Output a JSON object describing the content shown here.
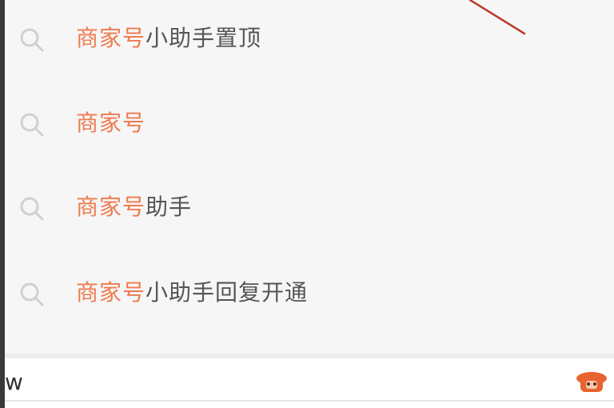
{
  "suggestions": [
    {
      "highlight": "商家号",
      "rest": "小助手置顶",
      "icon": "search-icon"
    },
    {
      "highlight": "商家号",
      "rest": "",
      "icon": "search-icon"
    },
    {
      "highlight": "商家号",
      "rest": "助手",
      "icon": "search-icon"
    },
    {
      "highlight": "商家号",
      "rest": "小助手回复开通",
      "icon": "search-icon"
    }
  ],
  "input_bar": {
    "text": "w",
    "app_icon": "orange-app-icon"
  },
  "colors": {
    "highlight": "#ee7b4f",
    "text": "#555555",
    "icon": "#d0d0d0",
    "annotation": "#c0392b",
    "background": "#f6f6f6"
  }
}
